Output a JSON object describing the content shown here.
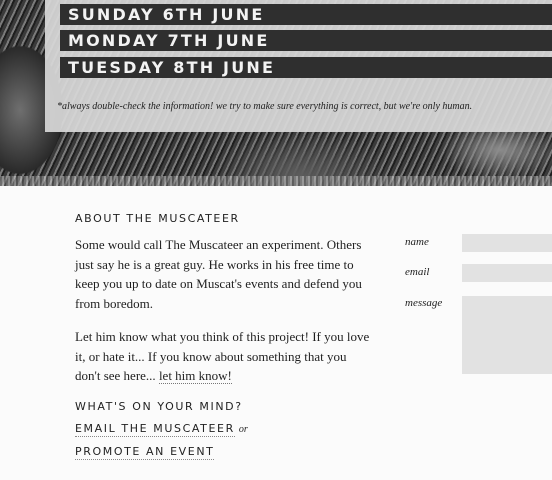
{
  "dates": [
    {
      "label": "SUNDAY 6TH JUNE"
    },
    {
      "label": "MONDAY 7TH JUNE"
    },
    {
      "label": "TUESDAY 8TH JUNE"
    }
  ],
  "disclaimer": "*always double-check the information! we try to make sure everything is correct, but we're only human.",
  "about": {
    "title": "ABOUT THE MUSCATEER",
    "paragraph1": "Some would call The Muscateer an experiment. Others just say he is a great guy. He works in his free time to keep you up to date on Muscat's events and defend you from boredom.",
    "paragraph2_text": "Let him know what you think of this project! If you love it, or hate it... If you know about something that you don't see here...",
    "paragraph2_link": "let him know!"
  },
  "cta": {
    "heading": "WHAT'S ON YOUR MIND?",
    "email_link": "EMAIL THE MUSCATEER",
    "or_text": "or",
    "promote_link": "PROMOTE AN EVENT"
  },
  "form": {
    "name_label": "name",
    "email_label": "email",
    "message_label": "message",
    "name_value": "",
    "email_value": "",
    "message_value": ""
  }
}
